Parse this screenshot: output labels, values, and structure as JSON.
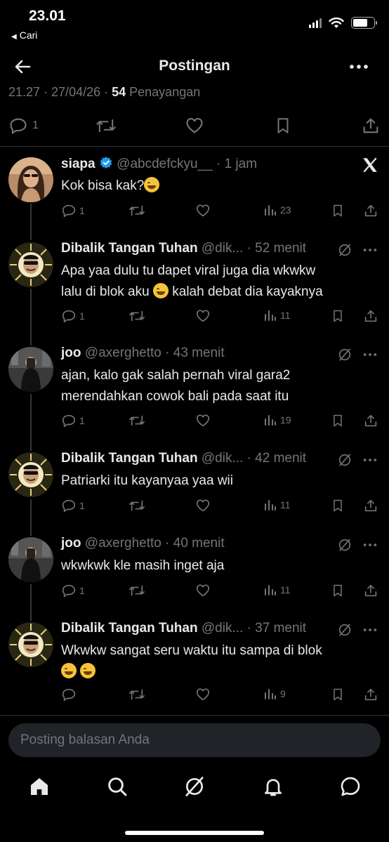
{
  "status_bar": {
    "time": "23.01",
    "back_app": "Cari"
  },
  "header": {
    "title": "Postingan"
  },
  "meta": {
    "time_date": "21.27 · 27/04/26 · ",
    "views_count": "54",
    "views_label": " Penayangan"
  },
  "main_actions": {
    "reply_count": "1"
  },
  "posts": [
    {
      "name": "siapa",
      "verified": true,
      "handle": "@abcdefckyu__",
      "time": "· 1 jam",
      "lines": [
        "Kok bisa kak?"
      ],
      "replies": "1",
      "views": "23",
      "emoji_icon": "loudly-crying-face-emoji"
    },
    {
      "name": "Dibalik Tangan Tuhan",
      "handle": "@dik...",
      "time": "· 52 menit",
      "lines": [
        "Apa yaa dulu tu dapet viral juga dia wkwkw",
        "lalu di blok aku",
        "kalah debat dia kayaknya"
      ],
      "replies": "1",
      "views": "11"
    },
    {
      "name": "joo",
      "handle": "@axerghetto",
      "time": "· 43 menit",
      "lines": [
        "ajan, kalo gak salah pernah viral gara2",
        "merendahkan cowok bali pada saat itu"
      ],
      "replies": "1",
      "views": "19"
    },
    {
      "name": "Dibalik Tangan Tuhan",
      "handle": "@dik...",
      "time": "· 42 menit",
      "lines": [
        "Patriarki itu kayanyaa yaa wii"
      ],
      "replies": "1",
      "views": "11"
    },
    {
      "name": "joo",
      "handle": "@axerghetto",
      "time": "· 40 menit",
      "lines": [
        "wkwkwk kle masih inget aja"
      ],
      "replies": "1",
      "views": "11"
    },
    {
      "name": "Dibalik Tangan Tuhan",
      "handle": "@dik...",
      "time": "· 37 menit",
      "lines": [
        "Wkwkw sangat seru waktu itu sampa di blok"
      ],
      "replies": "",
      "views": "9"
    }
  ],
  "reply_bar": {
    "placeholder": "Posting balasan Anda"
  },
  "colors": {
    "background": "#000000",
    "text_primary": "#e7e9ea",
    "text_secondary": "#71767b",
    "divider": "#2f3336",
    "verified_blue": "#1d9bf0"
  }
}
